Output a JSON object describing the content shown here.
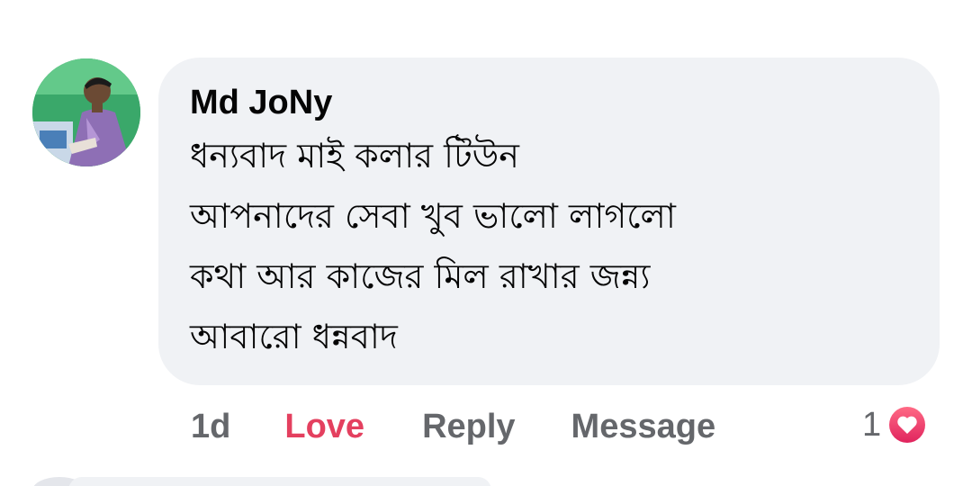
{
  "comment": {
    "author": "Md JoNy",
    "lines": [
      "ধন্যবাদ মাই কলার টিউন",
      "আপনাদের সেবা খুব ভালো লাগলো",
      "কথা আর কাজের মিল রাখার জন্ন্য",
      "আবারো ধন্নবাদ"
    ],
    "avatar_icon": "user-profile-photo"
  },
  "actions": {
    "time": "1d",
    "love_label": "Love",
    "reply_label": "Reply",
    "message_label": "Message"
  },
  "reactions": {
    "count": "1",
    "icon": "heart-icon"
  },
  "colors": {
    "bubble_bg": "#f0f2f5",
    "text": "#050505",
    "secondary_text": "#65676b",
    "love_accent": "#e4405f"
  }
}
